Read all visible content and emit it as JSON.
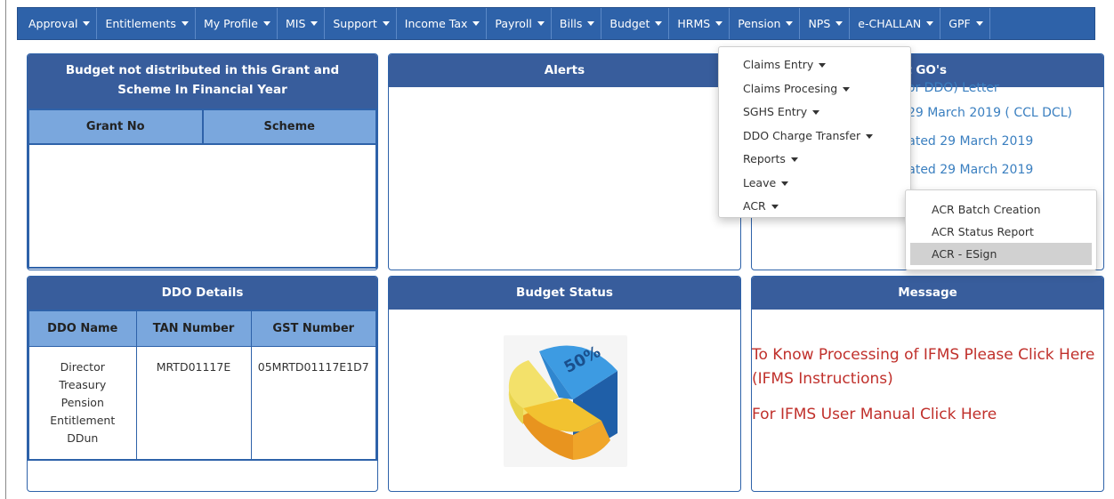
{
  "nav": {
    "items": [
      {
        "label": "Approval"
      },
      {
        "label": "Entitlements"
      },
      {
        "label": "My Profile"
      },
      {
        "label": "MIS"
      },
      {
        "label": "Support"
      },
      {
        "label": "Income Tax"
      },
      {
        "label": "Payroll"
      },
      {
        "label": "Bills"
      },
      {
        "label": "Budget"
      },
      {
        "label": "HRMS"
      },
      {
        "label": "Pension"
      },
      {
        "label": "NPS"
      },
      {
        "label": "e-CHALLAN"
      },
      {
        "label": "GPF"
      }
    ]
  },
  "hrms_menu": {
    "items": [
      {
        "label": "Claims Entry"
      },
      {
        "label": "Claims Procesing"
      },
      {
        "label": "SGHS Entry"
      },
      {
        "label": "DDO Charge Transfer"
      },
      {
        "label": "Reports"
      },
      {
        "label": "Leave"
      },
      {
        "label": "ACR"
      }
    ]
  },
  "acr_menu": {
    "items": [
      {
        "label": "ACR Batch Creation"
      },
      {
        "label": "ACR Status Report"
      },
      {
        "label": "ACR - ESign"
      }
    ],
    "active_index": 2
  },
  "budget_panel": {
    "title": "Budget not distributed in this Grant and Scheme In Financial Year",
    "col_grant": "Grant No",
    "col_scheme": "Scheme"
  },
  "alerts_panel": {
    "title": "Alerts"
  },
  "go_panel": {
    "title_visible": "est GO's",
    "items": [
      "g(For DDO) Letter",
      "ed 29 March 2019 ( CCL DCL)",
      "0 dated 29 March 2019",
      "1 dated 29 March 2019"
    ]
  },
  "ddo_panel": {
    "title": "DDO Details",
    "headers": [
      "DDO Name",
      "TAN Number",
      "GST Number"
    ],
    "row": {
      "name": "Director Treasury Pension Entitlement DDun",
      "tan": "MRTD01117E",
      "gst": "05MRTD01117E1D7"
    }
  },
  "status_panel": {
    "title": "Budget Status",
    "pie_label": "50%"
  },
  "message_panel": {
    "title": "Message",
    "line1": "To Know Processing of IFMS Please Click Here (IFMS Instructions)",
    "line2": "For IFMS User Manual Click Here"
  },
  "colors": {
    "nav_bg": "#2e62a9",
    "panel_head": "#385d9c",
    "table_head": "#7aa7dd",
    "link": "#3a7fc0",
    "message": "#c0302b"
  }
}
